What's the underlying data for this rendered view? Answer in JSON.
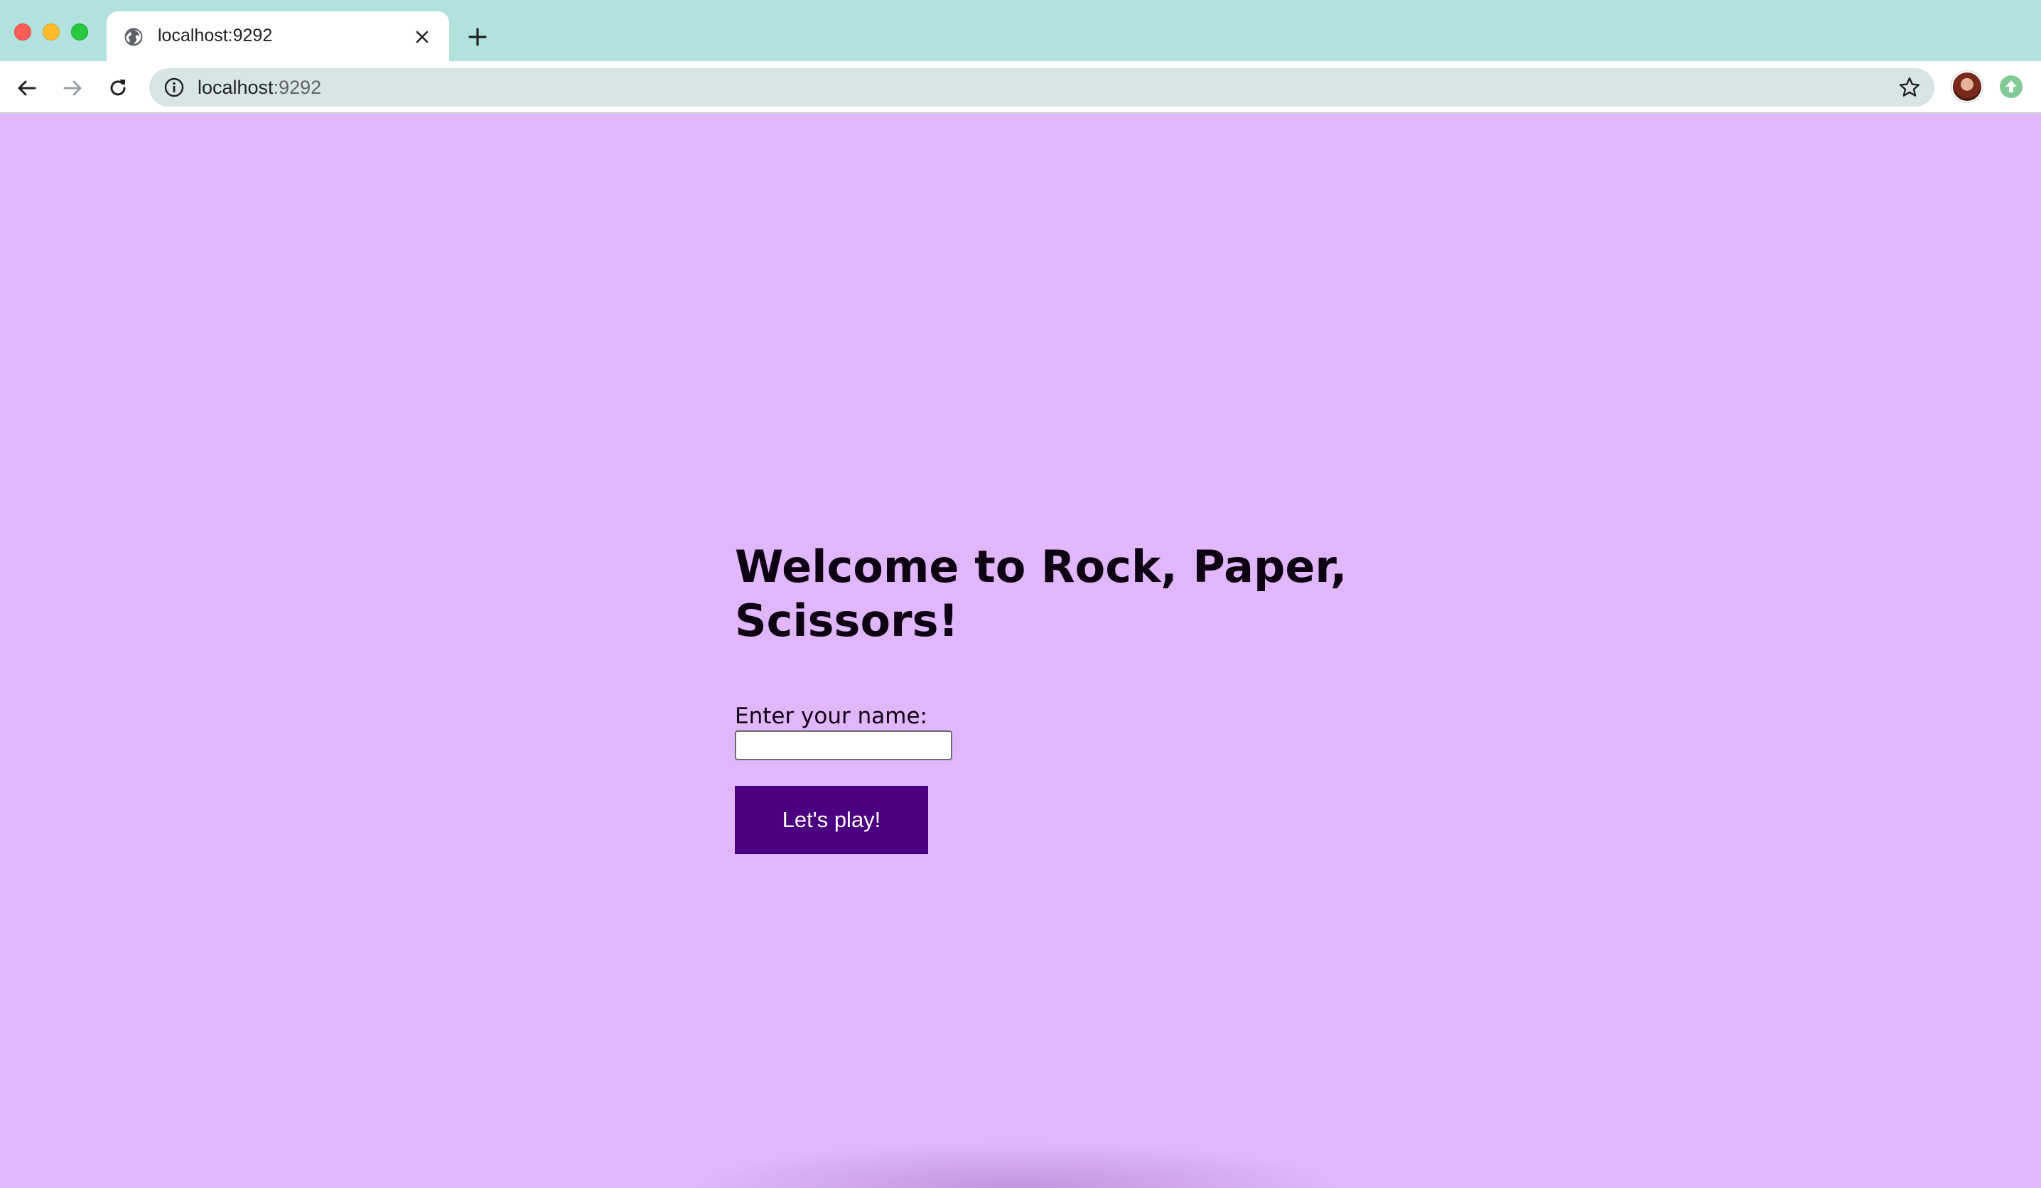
{
  "browser": {
    "tab_title": "localhost:9292",
    "url_host": "localhost",
    "url_port": ":9292",
    "colors": {
      "tabstrip": "#b1e2dd",
      "omnibox": "#d7e6e4"
    },
    "icons": {
      "tab_favicon": "globe-icon",
      "tab_close": "close-icon",
      "new_tab": "plus-icon",
      "back": "arrow-left-icon",
      "forward": "arrow-right-icon",
      "reload": "reload-icon",
      "site_info": "info-icon",
      "bookmark": "star-icon",
      "profile": "avatar",
      "update": "update-icon"
    }
  },
  "page": {
    "background": "#e0b7fa",
    "heading": "Welcome to Rock, Paper, Scissors!",
    "name_label": "Enter your name:",
    "name_input_value": "",
    "submit_label": "Let's play!",
    "button_color": "#4b0082"
  }
}
